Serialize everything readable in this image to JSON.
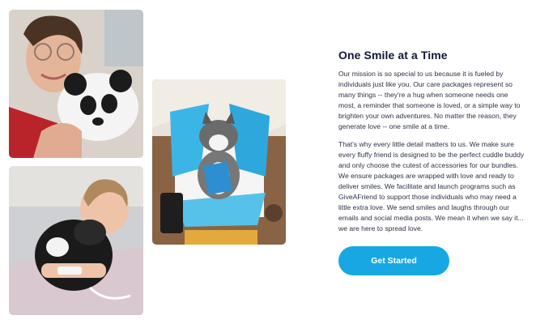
{
  "section": {
    "title": "One Smile at a Time",
    "paragraphs": [
      "Our mission is so special to us because it is fueled by individuals just like you. Our care packages represent so many things -- they're a hug when someone needs one most, a reminder that someone is loved, or a simple way to brighten your own adventures. No matter the reason, they generate love -- one smile at a time.",
      "That's why every little detail matters to us. We make sure every fluffy friend is designed to be the perfect cuddle buddy and only choose the cutest of accessories for our bundles. We ensure packages are wrapped with love and ready to deliver smiles. We facilitate and launch programs such as GiveAFriend to support those individuals who may need a little extra love. We send smiles and laughs through our emails and social media posts. We mean it when we say it... we are here to spread love."
    ],
    "cta_label": "Get Started"
  },
  "images": [
    {
      "name": "photo-woman-with-panda-plush"
    },
    {
      "name": "photo-child-hugging-panda-plush"
    },
    {
      "name": "photo-husky-plush-in-gift-box"
    }
  ],
  "colors": {
    "accent": "#17a8e3",
    "heading": "#131738",
    "body_text": "#2e3247"
  }
}
